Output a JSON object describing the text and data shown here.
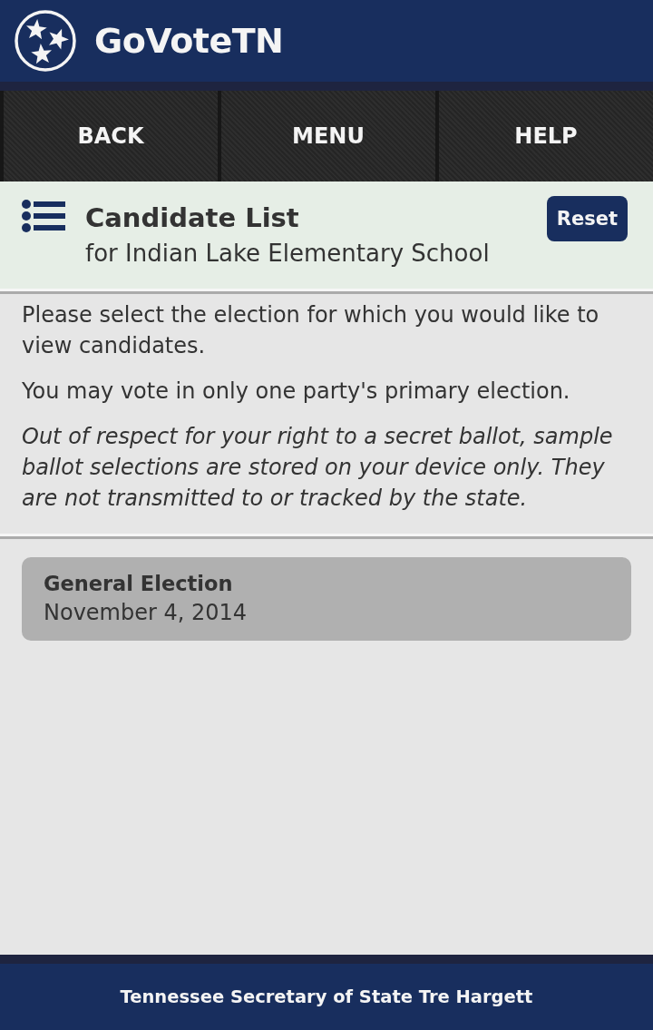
{
  "header": {
    "title": "GoVoteTN"
  },
  "nav": [
    {
      "label": "BACK"
    },
    {
      "label": "MENU"
    },
    {
      "label": "HELP"
    }
  ],
  "page_header": {
    "title": "Candidate List",
    "subtitle": "for Indian Lake Elementary School",
    "reset_button": "Reset"
  },
  "intro": [
    {
      "kind": "plain",
      "text": "Please select the election for which you would like to view candidates."
    },
    {
      "kind": "plain",
      "text": "You may vote in only one party's primary election."
    },
    {
      "kind": "italic",
      "text": "Out of respect for your right to a secret ballot, sample ballot selections are stored on your device only. They are not transmitted to or tracked by the state."
    }
  ],
  "elections": [
    {
      "name": "General Election",
      "date": "November 4, 2014"
    }
  ],
  "footer": {
    "text": "Tennessee Secretary of State Tre Hargett"
  }
}
